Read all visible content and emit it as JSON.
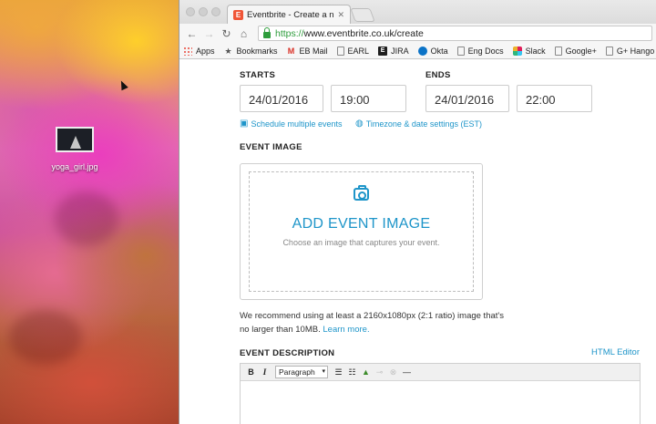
{
  "desktop": {
    "file_name": "yoga_girl.jpg"
  },
  "browser": {
    "tab_title": "Eventbrite - Create a new e",
    "tab_favicon": "E",
    "url_protocol": "https://",
    "url_rest": "www.eventbrite.co.uk/create",
    "bookmarks": [
      {
        "icon": "apps-icon",
        "label": "Apps"
      },
      {
        "icon": "star-icon",
        "label": "Bookmarks"
      },
      {
        "icon": "gmail-icon",
        "label": "EB Mail"
      },
      {
        "icon": "page-icon",
        "label": "EARL"
      },
      {
        "icon": "jira-icon",
        "label": "JIRA"
      },
      {
        "icon": "okta-icon",
        "label": "Okta"
      },
      {
        "icon": "page-icon",
        "label": "Eng Docs"
      },
      {
        "icon": "slack-icon",
        "label": "Slack"
      },
      {
        "icon": "page-icon",
        "label": "Google+"
      },
      {
        "icon": "page-icon",
        "label": "G+ Hango"
      }
    ]
  },
  "form": {
    "starts_label": "STARTS",
    "ends_label": "ENDS",
    "start_date": "24/01/2016",
    "start_time": "19:00",
    "end_date": "24/01/2016",
    "end_time": "22:00",
    "schedule_link": "Schedule multiple events",
    "timezone_link": "Timezone & date settings (EST)",
    "event_image_label": "EVENT IMAGE",
    "add_image_title": "ADD EVENT IMAGE",
    "add_image_subtitle": "Choose an image that captures your event.",
    "recommend_text": "We recommend using at least a 2160x1080px (2:1 ratio) image that's no larger than 10MB.",
    "learn_more": "Learn more.",
    "description_label": "EVENT DESCRIPTION",
    "html_editor_link": "HTML Editor",
    "format_select": "Paragraph"
  },
  "colors": {
    "link": "#1e95c9",
    "brand": "#f05537",
    "secure": "#2e9d3c"
  }
}
